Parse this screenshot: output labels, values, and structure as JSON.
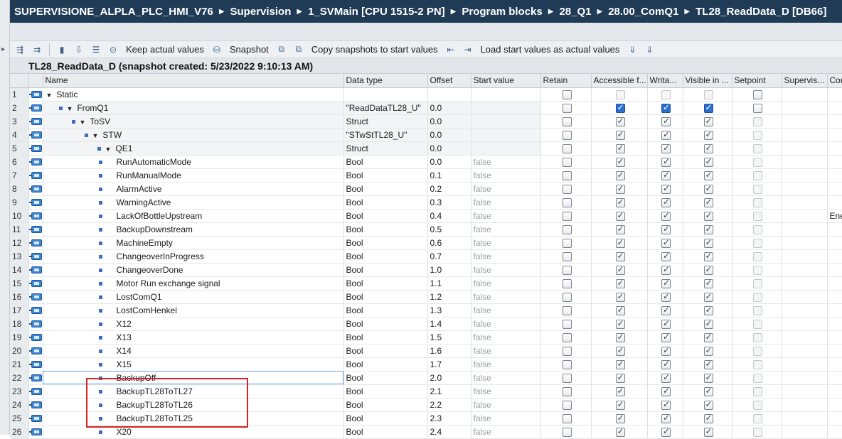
{
  "breadcrumb": [
    "SUPERVISIONE_ALPLA_PLC_HMI_V76",
    "Supervision",
    "1_SVMain [CPU 1515-2 PN]",
    "Program blocks",
    "28_Q1",
    "28.00_ComQ1",
    "TL28_ReadData_D [DB66]"
  ],
  "toolbar": {
    "keep_actual_values": "Keep actual values",
    "snapshot": "Snapshot",
    "copy_snapshots": "Copy snapshots to start values",
    "load_start_values": "Load start values as actual values"
  },
  "snapshot_title": "TL28_ReadData_D (snapshot created: 5/23/2022 9:10:13 AM)",
  "columns": [
    "Name",
    "Data type",
    "Offset",
    "Start value",
    "Retain",
    "Accessible f...",
    "Writa...",
    "Visible in ...",
    "Setpoint",
    "Supervis...",
    "Cor"
  ],
  "rows": [
    {
      "num": "1",
      "name": "Static",
      "type": "",
      "offset": "",
      "start": "",
      "ext": ""
    },
    {
      "num": "2",
      "name": "FromQ1",
      "type": "\"ReadDataTL28_U\"",
      "offset": "0.0",
      "start": "",
      "ext": ""
    },
    {
      "num": "3",
      "name": "ToSV",
      "type": "Struct",
      "offset": "0.0",
      "start": "",
      "ext": ""
    },
    {
      "num": "4",
      "name": "STW",
      "type": "\"STwStTL28_U\"",
      "offset": "0.0",
      "start": "",
      "ext": ""
    },
    {
      "num": "5",
      "name": "QE1",
      "type": "Struct",
      "offset": "0.0",
      "start": "",
      "ext": ""
    },
    {
      "num": "6",
      "name": "RunAutomaticMode",
      "type": "Bool",
      "offset": "0.0",
      "start": "false",
      "ext": ""
    },
    {
      "num": "7",
      "name": "RunManualMode",
      "type": "Bool",
      "offset": "0.1",
      "start": "false",
      "ext": ""
    },
    {
      "num": "8",
      "name": "AlarmActive",
      "type": "Bool",
      "offset": "0.2",
      "start": "false",
      "ext": ""
    },
    {
      "num": "9",
      "name": "WarningActive",
      "type": "Bool",
      "offset": "0.3",
      "start": "false",
      "ext": ""
    },
    {
      "num": "10",
      "name": "LackOfBottleUpstream",
      "type": "Bool",
      "offset": "0.4",
      "start": "false",
      "ext": "Ene"
    },
    {
      "num": "11",
      "name": "BackupDownstream",
      "type": "Bool",
      "offset": "0.5",
      "start": "false",
      "ext": ""
    },
    {
      "num": "12",
      "name": "MachineEmpty",
      "type": "Bool",
      "offset": "0.6",
      "start": "false",
      "ext": ""
    },
    {
      "num": "13",
      "name": "ChangeoverInProgress",
      "type": "Bool",
      "offset": "0.7",
      "start": "false",
      "ext": ""
    },
    {
      "num": "14",
      "name": "ChangeoverDone",
      "type": "Bool",
      "offset": "1.0",
      "start": "false",
      "ext": ""
    },
    {
      "num": "15",
      "name": "Motor Run exchange signal",
      "type": "Bool",
      "offset": "1.1",
      "start": "false",
      "ext": ""
    },
    {
      "num": "16",
      "name": "LostComQ1",
      "type": "Bool",
      "offset": "1.2",
      "start": "false",
      "ext": ""
    },
    {
      "num": "17",
      "name": "LostComHenkel",
      "type": "Bool",
      "offset": "1.3",
      "start": "false",
      "ext": ""
    },
    {
      "num": "18",
      "name": "X12",
      "type": "Bool",
      "offset": "1.4",
      "start": "false",
      "ext": ""
    },
    {
      "num": "19",
      "name": "X13",
      "type": "Bool",
      "offset": "1.5",
      "start": "false",
      "ext": ""
    },
    {
      "num": "20",
      "name": "X14",
      "type": "Bool",
      "offset": "1.6",
      "start": "false",
      "ext": ""
    },
    {
      "num": "21",
      "name": "X15",
      "type": "Bool",
      "offset": "1.7",
      "start": "false",
      "ext": ""
    },
    {
      "num": "22",
      "name": "BackupOff",
      "type": "Bool",
      "offset": "2.0",
      "start": "false",
      "ext": ""
    },
    {
      "num": "23",
      "name": "BackupTL28ToTL27",
      "type": "Bool",
      "offset": "2.1",
      "start": "false",
      "ext": ""
    },
    {
      "num": "24",
      "name": "BackupTL28ToTL26",
      "type": "Bool",
      "offset": "2.2",
      "start": "false",
      "ext": ""
    },
    {
      "num": "25",
      "name": "BackupTL28ToTL25",
      "type": "Bool",
      "offset": "2.3",
      "start": "false",
      "ext": ""
    },
    {
      "num": "26",
      "name": "X20",
      "type": "Bool",
      "offset": "2.4",
      "start": "false",
      "ext": ""
    }
  ],
  "colors": {
    "title_bg": "#1f3b55",
    "highlight": "#d42323",
    "checkbox_blue": "#2b6fd0"
  }
}
